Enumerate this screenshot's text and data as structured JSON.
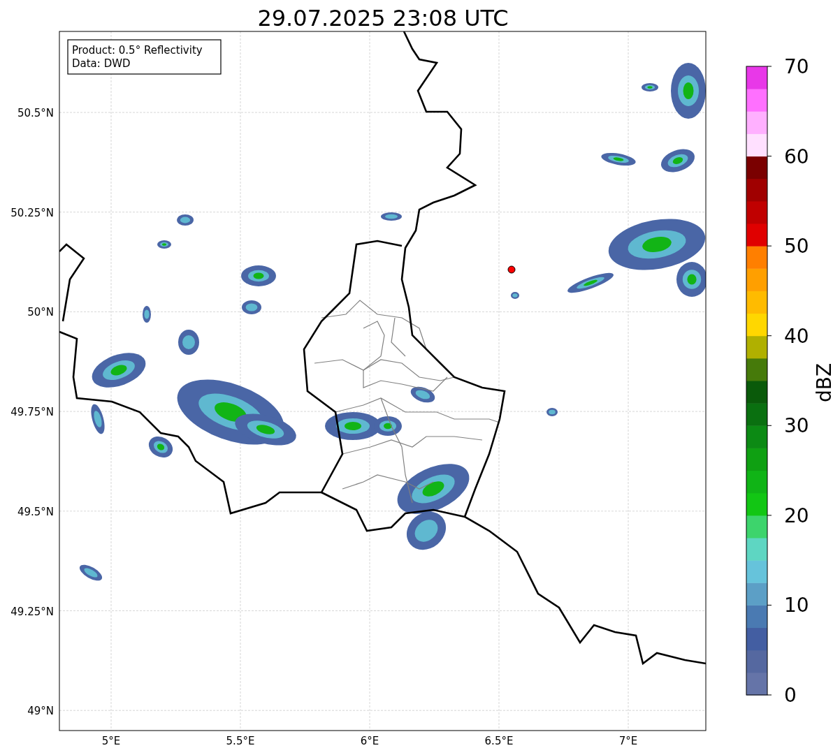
{
  "title": "29.07.2025 23:08 UTC",
  "annotation": [
    "Product: 0.5° Reflectivity",
    "Data: DWD"
  ],
  "lat_ticks": [
    "50.5°N",
    "50.25°N",
    "50°N",
    "49.75°N",
    "49.5°N",
    "49.25°N",
    "49°N"
  ],
  "lon_ticks": [
    "5°E",
    "5.5°E",
    "6°E",
    "6.5°E",
    "7°E"
  ],
  "colorbar": {
    "label": "dBZ",
    "ticks": [
      "70",
      "60",
      "50",
      "40",
      "30",
      "20",
      "10",
      "0"
    ],
    "levels": [
      {
        "color": "#6574a8"
      },
      {
        "color": "#5568a0"
      },
      {
        "color": "#435ea2"
      },
      {
        "color": "#4a7ab2"
      },
      {
        "color": "#5c9fc6"
      },
      {
        "color": "#66c3db"
      },
      {
        "color": "#5ed6c2"
      },
      {
        "color": "#3dd46c"
      },
      {
        "color": "#12c614"
      },
      {
        "color": "#10b416"
      },
      {
        "color": "#0fa012"
      },
      {
        "color": "#0c8a14"
      },
      {
        "color": "#0a7010"
      },
      {
        "color": "#0a5a0a"
      },
      {
        "color": "#467a0a"
      },
      {
        "color": "#b0b000"
      },
      {
        "color": "#ffd700"
      },
      {
        "color": "#ffbb00"
      },
      {
        "color": "#ff9f00"
      },
      {
        "color": "#ff7f00"
      },
      {
        "color": "#e00000"
      },
      {
        "color": "#c00000"
      },
      {
        "color": "#a00000"
      },
      {
        "color": "#7a0000"
      },
      {
        "color": "#ffe0ff"
      },
      {
        "color": "#ffb0ff"
      },
      {
        "color": "#ff70ff"
      },
      {
        "color": "#e838e8"
      }
    ]
  }
}
